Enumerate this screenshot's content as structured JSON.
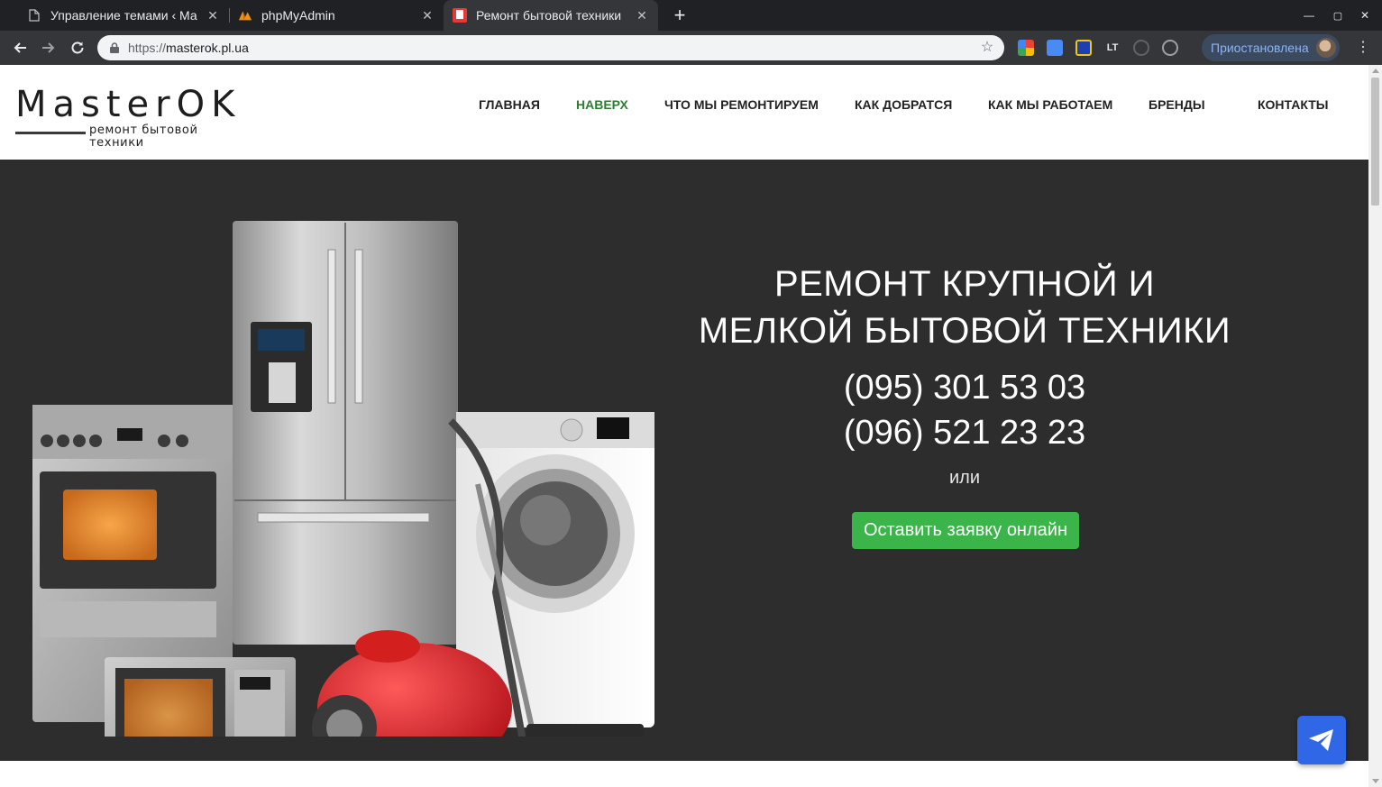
{
  "browser": {
    "tabs": [
      {
        "title": "Управление темами ‹ Ма",
        "favicon": "page-icon",
        "active": false
      },
      {
        "title": "phpMyAdmin",
        "favicon": "phpmyadmin-icon",
        "active": false
      },
      {
        "title": "Ремонт бытовой техники",
        "favicon": "site-icon",
        "active": true
      }
    ],
    "new_tab": "+",
    "url_protocol": "https://",
    "url_host": "masterok.pl.ua",
    "profile_status": "Приостановлена",
    "colors": {
      "tabstrip": "#202124",
      "toolbar": "#35363a",
      "omnibox": "#f1f3f4",
      "accent": "#8ab4f8"
    }
  },
  "site": {
    "logo": {
      "wordmark": "MasterOK",
      "tagline": "ремонт бытовой техники"
    },
    "nav": [
      {
        "label": "ГЛАВНАЯ",
        "active": false
      },
      {
        "label": "НАВЕРХ",
        "active": true
      },
      {
        "label": "ЧТО МЫ РЕМОНТИРУЕМ",
        "active": false
      },
      {
        "label": "КАК ДОБРАТСЯ",
        "active": false
      },
      {
        "label": "КАК МЫ РАБОТАЕМ",
        "active": false
      },
      {
        "label": "БРЕНДЫ",
        "active": false
      },
      {
        "label": "КОНТАКТЫ",
        "active": false
      }
    ],
    "hero": {
      "title_line1": "РЕМОНТ КРУПНОЙ И",
      "title_line2": "МЕЛКОЙ БЫТОВОЙ ТЕХНИКИ",
      "phone1": "(095) 301 53 03",
      "phone2": "(096) 521 23 23",
      "or_text": "или",
      "cta_label": "Оставить заявку онлайн"
    },
    "floating_button": "telegram-icon",
    "colors": {
      "hero_bg": "#2d2d2d",
      "cta": "#3bb54a",
      "nav_active": "#2e7d32",
      "floating": "#2f67e6"
    }
  }
}
